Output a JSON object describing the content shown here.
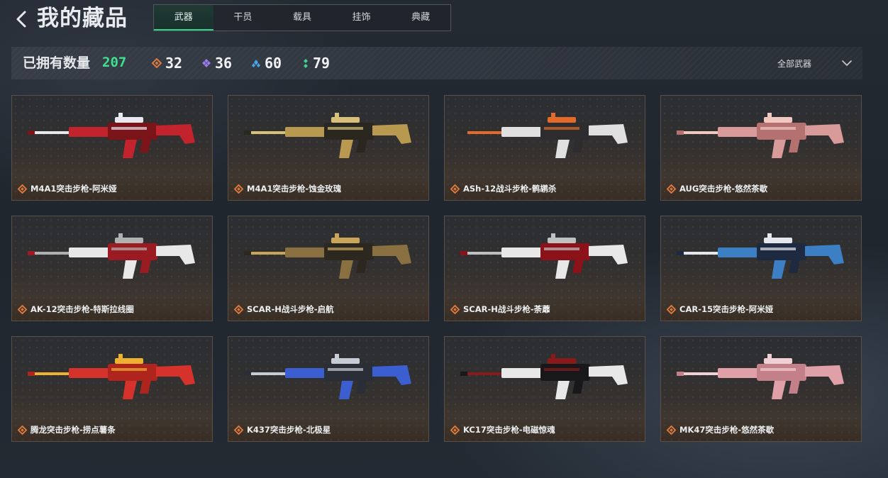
{
  "header": {
    "back_icon": "chevron-left-icon",
    "title": "我的藏品"
  },
  "tabs": [
    {
      "label": "武器",
      "active": true
    },
    {
      "label": "干员",
      "active": false
    },
    {
      "label": "载具",
      "active": false
    },
    {
      "label": "挂饰",
      "active": false
    },
    {
      "label": "典藏",
      "active": false
    }
  ],
  "stats": {
    "owned_label": "已拥有数量",
    "owned_count": "207",
    "rarities": [
      {
        "icon": "orange-diamond-icon",
        "color": "#e07a3c",
        "count": "32"
      },
      {
        "icon": "purple-diamond-icon",
        "color": "#9b7fe0",
        "count": "36"
      },
      {
        "icon": "blue-diamond-icon",
        "color": "#4aa3e6",
        "count": "60"
      },
      {
        "icon": "green-diamond-icon",
        "color": "#3fd38f",
        "count": "79"
      }
    ]
  },
  "filter": {
    "selected": "全部武器",
    "icon": "chevron-down-icon"
  },
  "weapons": [
    {
      "name": "M4A1突击步枪-阿米娅",
      "accent": "#c2232c",
      "base": "#7a1418",
      "detail": "#e8e8f0"
    },
    {
      "name": "M4A1突击步枪-蚀金玫瑰",
      "accent": "#b9994f",
      "base": "#2a2620",
      "detail": "#d8c07a"
    },
    {
      "name": "ASh-12战斗步枪-鹘鹕杀",
      "accent": "#e0e0e0",
      "base": "#2d2d30",
      "detail": "#e46a2a"
    },
    {
      "name": "AUG突击步枪-悠然茶歇",
      "accent": "#d99a9a",
      "base": "#b57070",
      "detail": "#f0c8c0"
    },
    {
      "name": "AK-12突击步枪-特斯拉线圈",
      "accent": "#e8e8e8",
      "base": "#9a1c22",
      "detail": "#b0b0b0"
    },
    {
      "name": "SCAR-H战斗步枪-启航",
      "accent": "#8a7040",
      "base": "#2c2820",
      "detail": "#c9a55a"
    },
    {
      "name": "SCAR-H战斗步枪-荼蘼",
      "accent": "#e8e8e8",
      "base": "#8a1218",
      "detail": "#c0c0c0"
    },
    {
      "name": "CAR-15突击步枪-阿米娅",
      "accent": "#3d7fc4",
      "base": "#1d2a40",
      "detail": "#e4e8ee"
    },
    {
      "name": "腾龙突击步枪-捞点薯条",
      "accent": "#d4322a",
      "base": "#b0241e",
      "detail": "#f0b030"
    },
    {
      "name": "K437突击步枪-北极星",
      "accent": "#3b5fd0",
      "base": "#2a2e36",
      "detail": "#c8ccd6"
    },
    {
      "name": "KC17突击步枪-电磁惊魂",
      "accent": "#e8e8e8",
      "base": "#18181a",
      "detail": "#8a1a1a"
    },
    {
      "name": "MK47突击步枪-悠然茶歇",
      "accent": "#e0a0a8",
      "base": "#c48088",
      "detail": "#f0d0d4"
    }
  ]
}
